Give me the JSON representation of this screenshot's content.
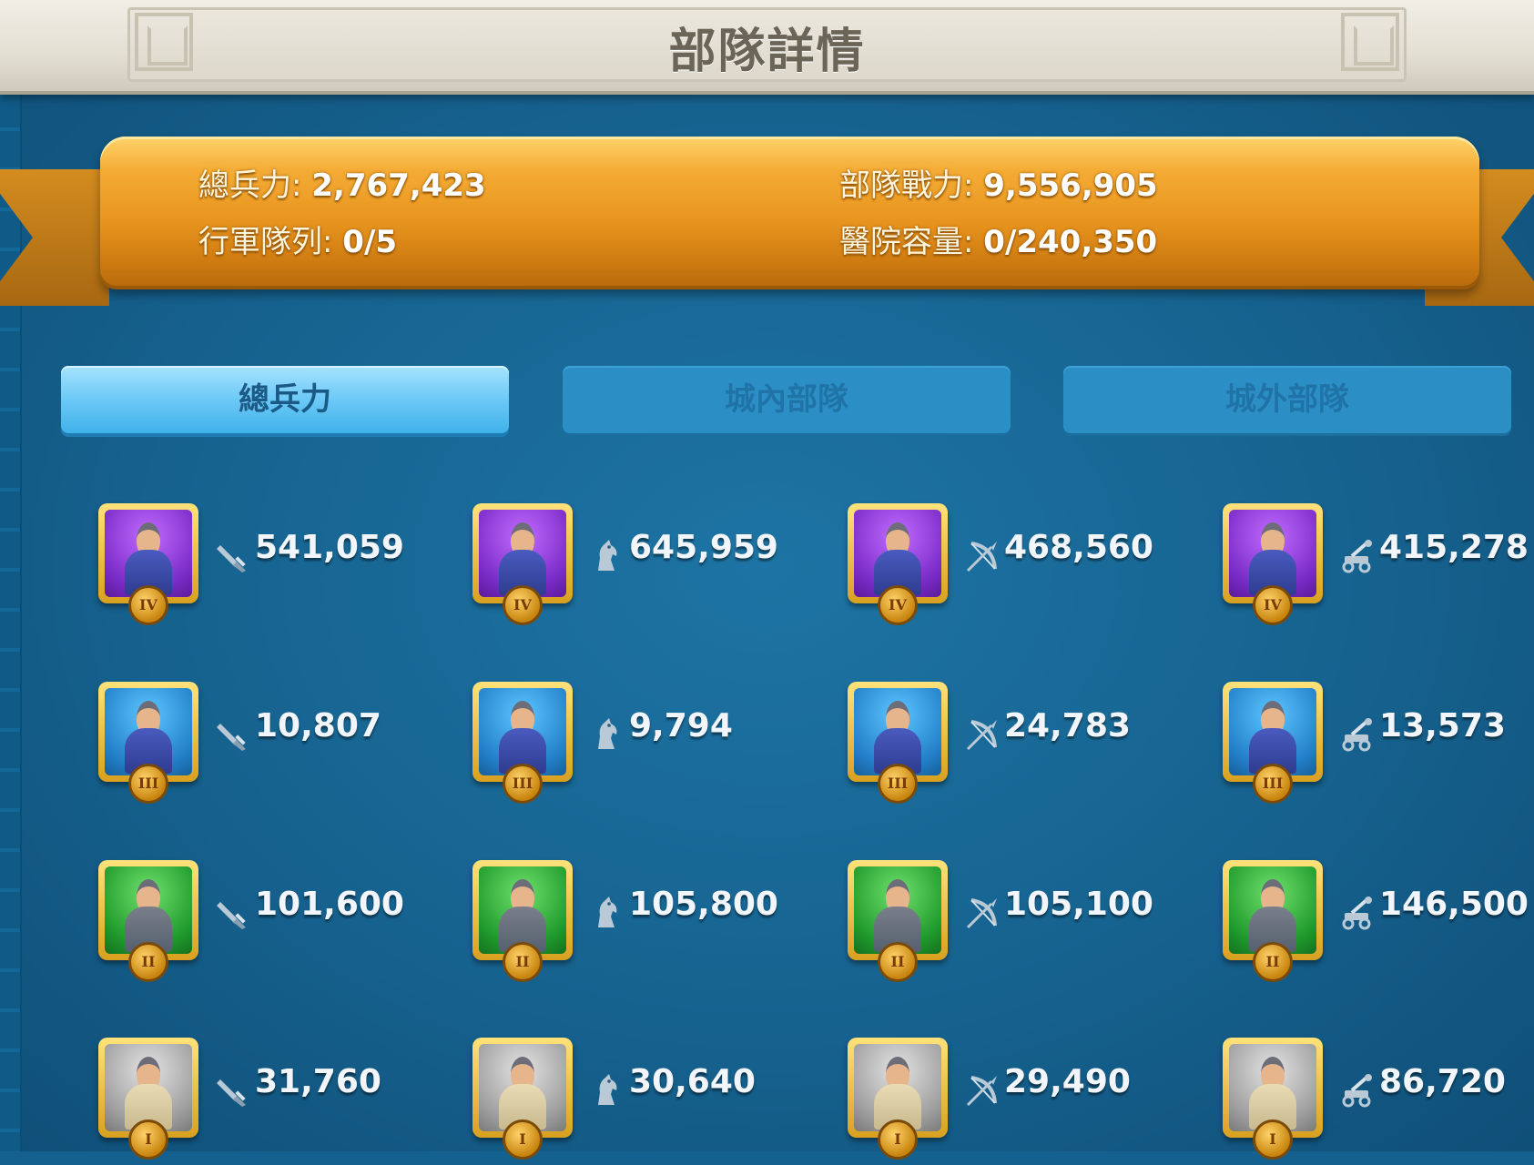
{
  "window": {
    "title": "部隊詳情"
  },
  "summary": {
    "total_troops_label": "總兵力:",
    "total_troops_value": "2,767,423",
    "troop_power_label": "部隊戰力:",
    "troop_power_value": "9,556,905",
    "march_queue_label": "行軍隊列:",
    "march_queue_value": "0/5",
    "hospital_label": "醫院容量:",
    "hospital_value": "0/240,350"
  },
  "tabs": [
    {
      "label": "總兵力",
      "active": true
    },
    {
      "label": "城內部隊",
      "active": false
    },
    {
      "label": "城外部隊",
      "active": false
    }
  ],
  "troops": [
    [
      {
        "tier": "IV",
        "type": "infantry-icon",
        "count": "541,059"
      },
      {
        "tier": "IV",
        "type": "cavalry-icon",
        "count": "645,959"
      },
      {
        "tier": "IV",
        "type": "archer-icon",
        "count": "468,560"
      },
      {
        "tier": "IV",
        "type": "siege-icon",
        "count": "415,278"
      }
    ],
    [
      {
        "tier": "III",
        "type": "infantry-icon",
        "count": "10,807"
      },
      {
        "tier": "III",
        "type": "cavalry-icon",
        "count": "9,794"
      },
      {
        "tier": "III",
        "type": "archer-icon",
        "count": "24,783"
      },
      {
        "tier": "III",
        "type": "siege-icon",
        "count": "13,573"
      }
    ],
    [
      {
        "tier": "II",
        "type": "infantry-icon",
        "count": "101,600"
      },
      {
        "tier": "II",
        "type": "cavalry-icon",
        "count": "105,800"
      },
      {
        "tier": "II",
        "type": "archer-icon",
        "count": "105,100"
      },
      {
        "tier": "II",
        "type": "siege-icon",
        "count": "146,500"
      }
    ],
    [
      {
        "tier": "I",
        "type": "infantry-icon",
        "count": "31,760"
      },
      {
        "tier": "I",
        "type": "cavalry-icon",
        "count": "30,640"
      },
      {
        "tier": "I",
        "type": "archer-icon",
        "count": "29,490"
      },
      {
        "tier": "I",
        "type": "siege-icon",
        "count": "86,720"
      }
    ]
  ],
  "colors": {
    "background": "#16628f",
    "ribbon": "#e8951f",
    "tab_active": "#6cc9f6",
    "tab_inactive": "#2b8fc5",
    "tier_IV": "#7a2cc7",
    "tier_III": "#2380c9",
    "tier_II": "#1f9a2c",
    "tier_I": "#9e9e9e"
  }
}
